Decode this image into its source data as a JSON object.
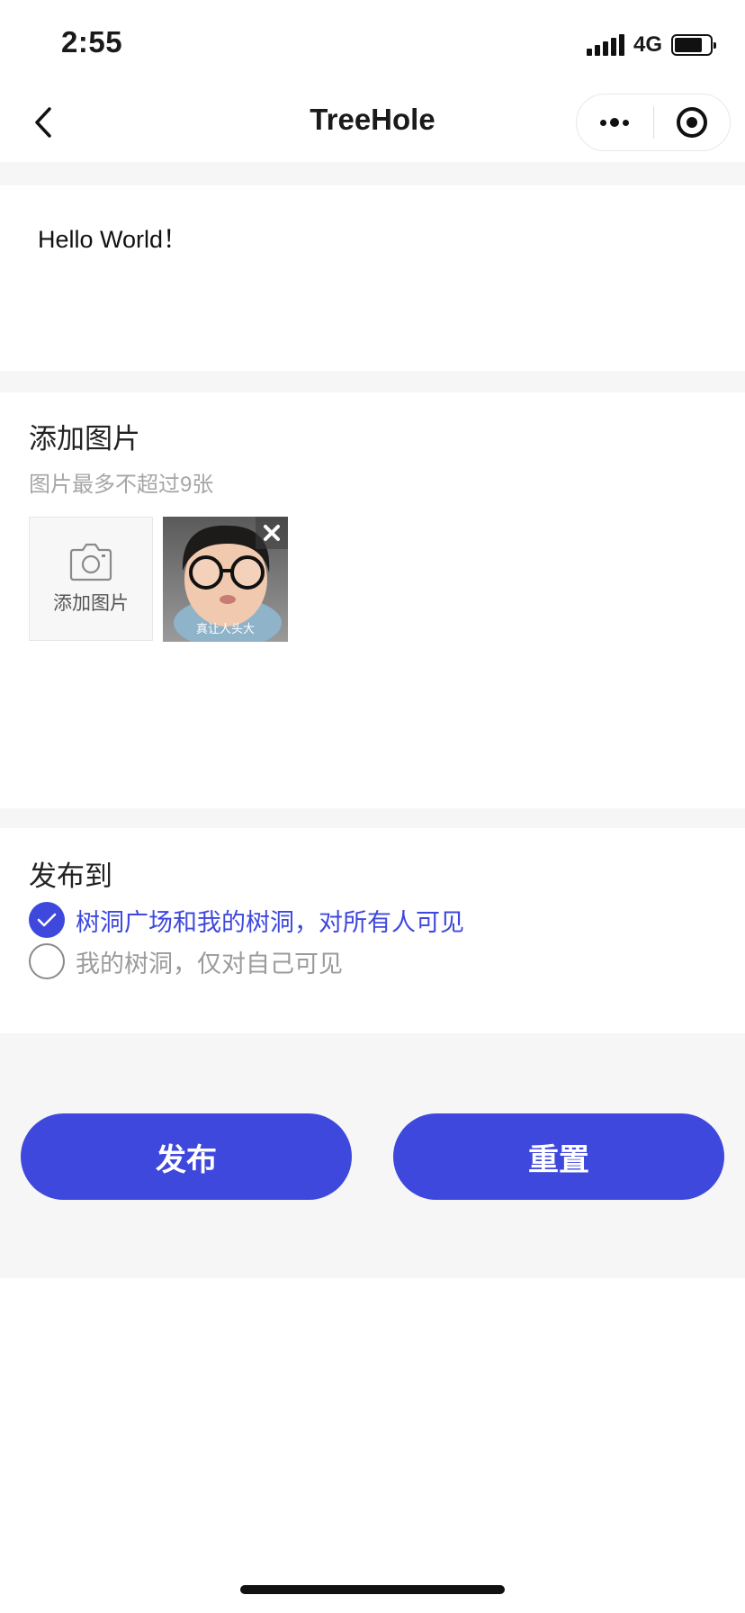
{
  "status_bar": {
    "time": "2:55",
    "network": "4G",
    "icons": [
      "signal-icon",
      "battery-icon"
    ]
  },
  "nav": {
    "title": "TreeHole",
    "icons": [
      "back-chevron-icon",
      "more-dots-icon",
      "close-target-icon"
    ]
  },
  "post": {
    "text": "Hello World！"
  },
  "images": {
    "title": "添加图片",
    "hint": "图片最多不超过9张",
    "add_label": "添加图片",
    "items": [
      {
        "caption": "真让人头大",
        "icon": "remove-icon"
      }
    ]
  },
  "publish": {
    "title": "发布到",
    "options": [
      {
        "label": "树洞广场和我的树洞，对所有人可见",
        "checked": true
      },
      {
        "label": "我的树洞，仅对自己可见",
        "checked": false
      }
    ]
  },
  "actions": {
    "publish_label": "发布",
    "reset_label": "重置"
  },
  "colors": {
    "accent": "#3f48dd",
    "section_gap": "#f6f6f6",
    "hint_text": "#a6a6a6"
  }
}
